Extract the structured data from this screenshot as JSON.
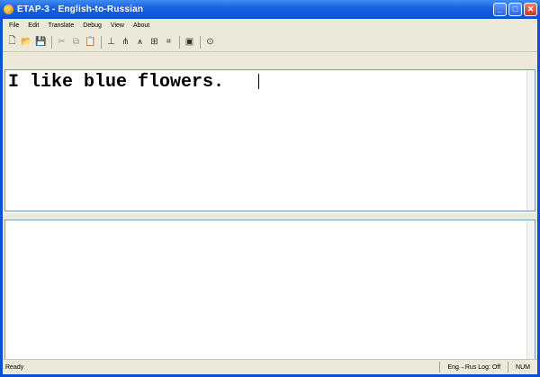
{
  "window": {
    "title": "ETAP-3 - English-to-Russian",
    "minimize_label": "_",
    "maximize_label": "□",
    "close_label": "✕"
  },
  "menu": [
    "File",
    "Edit",
    "Translate",
    "Debug",
    "View",
    "About"
  ],
  "toolbar": {
    "icons": [
      "new-document-icon",
      "open-folder-icon",
      "save-icon",
      "cut-icon",
      "copy-icon",
      "paste-icon",
      "translate-icon",
      "syntax-tree-icon",
      "morphology-icon",
      "lexicon-icon",
      "rules-icon",
      "options-icon",
      "help-icon"
    ],
    "glyphs": {
      "new": "🗋",
      "open": "📂",
      "save": "💾",
      "cut": "✂",
      "copy": "⧉",
      "paste": "📋",
      "translate": "⊥",
      "tree": "⋔",
      "morph": "⩚",
      "lexicon": "⊞",
      "rules": "⌗",
      "options": "▣",
      "help": "⊙"
    }
  },
  "editor": {
    "source_text": "I like blue flowers.",
    "target_text": ""
  },
  "status": {
    "left": "Ready",
    "mode": "Eng→Rus Log: Off",
    "extra": "NUM"
  },
  "colors": {
    "titlebar": "#0a4fd6",
    "window_bg": "#ece9d8",
    "close_button": "#c4391a"
  }
}
